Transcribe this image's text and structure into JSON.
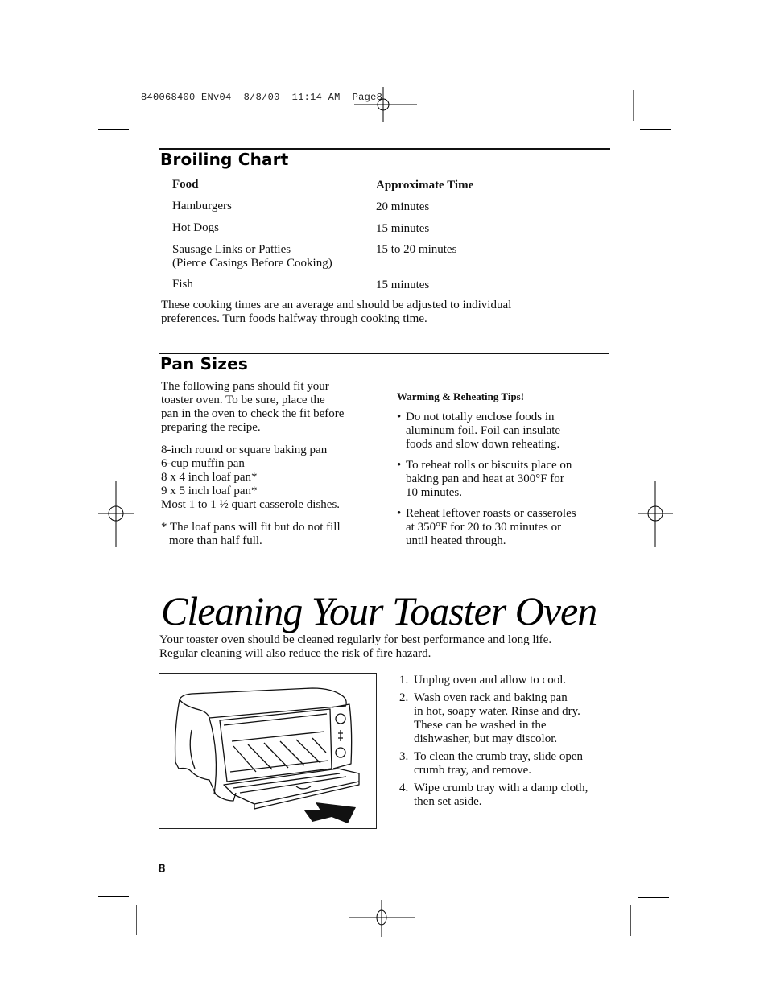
{
  "slug": {
    "job_id": "840068400",
    "version": "ENv04",
    "date": "8/8/00",
    "time": "11:14 AM",
    "page_label": "Page",
    "page_number": "8"
  },
  "broiling_chart": {
    "title": "Broiling Chart",
    "col_food": "Food",
    "col_time": "Approximate Time",
    "rows": [
      {
        "food": "Hamburgers",
        "note": "",
        "time": "20 minutes"
      },
      {
        "food": "Hot Dogs",
        "note": "",
        "time": "15 minutes"
      },
      {
        "food": "Sausage Links or Patties",
        "note": "(Pierce Casings Before Cooking)",
        "time": "15 to 20 minutes"
      },
      {
        "food": "Fish",
        "note": "",
        "time": "15 minutes"
      }
    ],
    "note_line1": "These cooking times are an average and should be adjusted to individual",
    "note_line2": "preferences. Turn foods halfway through cooking time."
  },
  "pan_sizes": {
    "title": "Pan Sizes",
    "intro": [
      "The following pans should fit your",
      "toaster oven. To be sure, place the",
      "pan in the oven to check the fit before",
      "preparing the recipe."
    ],
    "pans": [
      "8-inch round or square baking pan",
      "6-cup muffin pan",
      "8 x 4 inch loaf pan*",
      "9 x 5 inch loaf pan*",
      "Most 1 to 1 ½ quart casserole dishes."
    ],
    "footnote": [
      "* The loaf pans will fit but do not fill",
      "more than half full."
    ]
  },
  "tips": {
    "title": "Warming & Reheating Tips!",
    "items": [
      [
        "Do not totally enclose foods in",
        "aluminum foil. Foil can insulate",
        "foods and slow down reheating."
      ],
      [
        "To reheat rolls or biscuits place on",
        "baking pan and heat at 300°F for",
        "10 minutes."
      ],
      [
        "Reheat leftover roasts or casseroles",
        "at 350°F for 20 to 30 minutes or",
        "until heated through."
      ]
    ]
  },
  "cleaning": {
    "title": "Cleaning Your Toaster Oven",
    "intro_line1": "Your toaster oven should be cleaned regularly for best performance and long life.",
    "intro_line2": "Regular cleaning will also reduce the risk of fire hazard.",
    "figure_label": "toaster-oven-illustration",
    "steps": [
      {
        "num": "1.",
        "lines": [
          "Unplug oven and allow to cool."
        ]
      },
      {
        "num": "2.",
        "lines": [
          "Wash oven rack and baking pan",
          "in hot, soapy water. Rinse and dry.",
          "These can be washed in the",
          "dishwasher, but may discolor."
        ]
      },
      {
        "num": "3.",
        "lines": [
          "To clean the crumb tray, slide open",
          "crumb tray, and remove."
        ]
      },
      {
        "num": "4.",
        "lines": [
          "Wipe crumb tray with a damp cloth,",
          "then set aside."
        ]
      }
    ]
  },
  "footer": {
    "page_number": "8"
  }
}
